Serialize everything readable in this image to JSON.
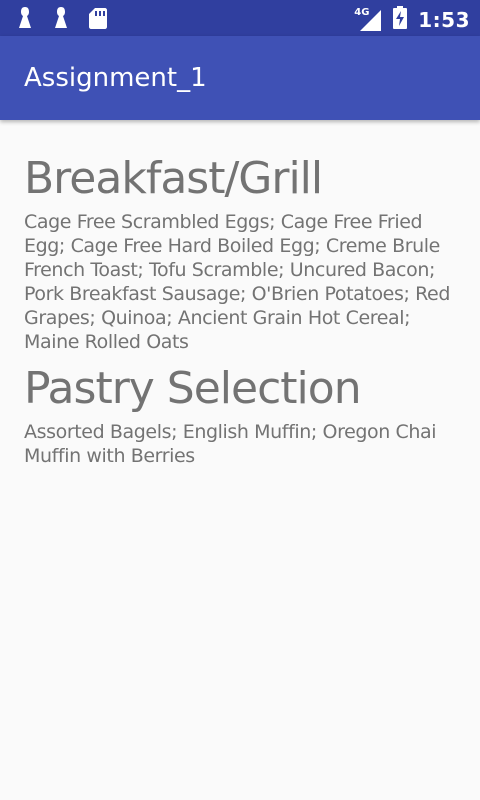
{
  "status_bar": {
    "left_icons": [
      "notification-icon",
      "notification-icon",
      "sd-card-icon"
    ],
    "network_type": "4G",
    "time": "1:53",
    "color": "#303f9f"
  },
  "app_bar": {
    "title": "Assignment_1",
    "color": "#3f51b5"
  },
  "sections": [
    {
      "title": "Breakfast/Grill",
      "items": "Cage Free Scrambled Eggs; Cage Free Fried Egg; Cage Free Hard Boiled Egg; Creme Brule French Toast; Tofu Scramble; Uncured Bacon; Pork Breakfast Sausage; O'Brien Potatoes; Red Grapes; Quinoa; Ancient Grain Hot Cereal; Maine Rolled Oats"
    },
    {
      "title": "Pastry Selection",
      "items": "Assorted Bagels; English Muffin; Oregon Chai Muffin with Berries"
    }
  ],
  "text_color": "#737373",
  "background_color": "#fafafa"
}
